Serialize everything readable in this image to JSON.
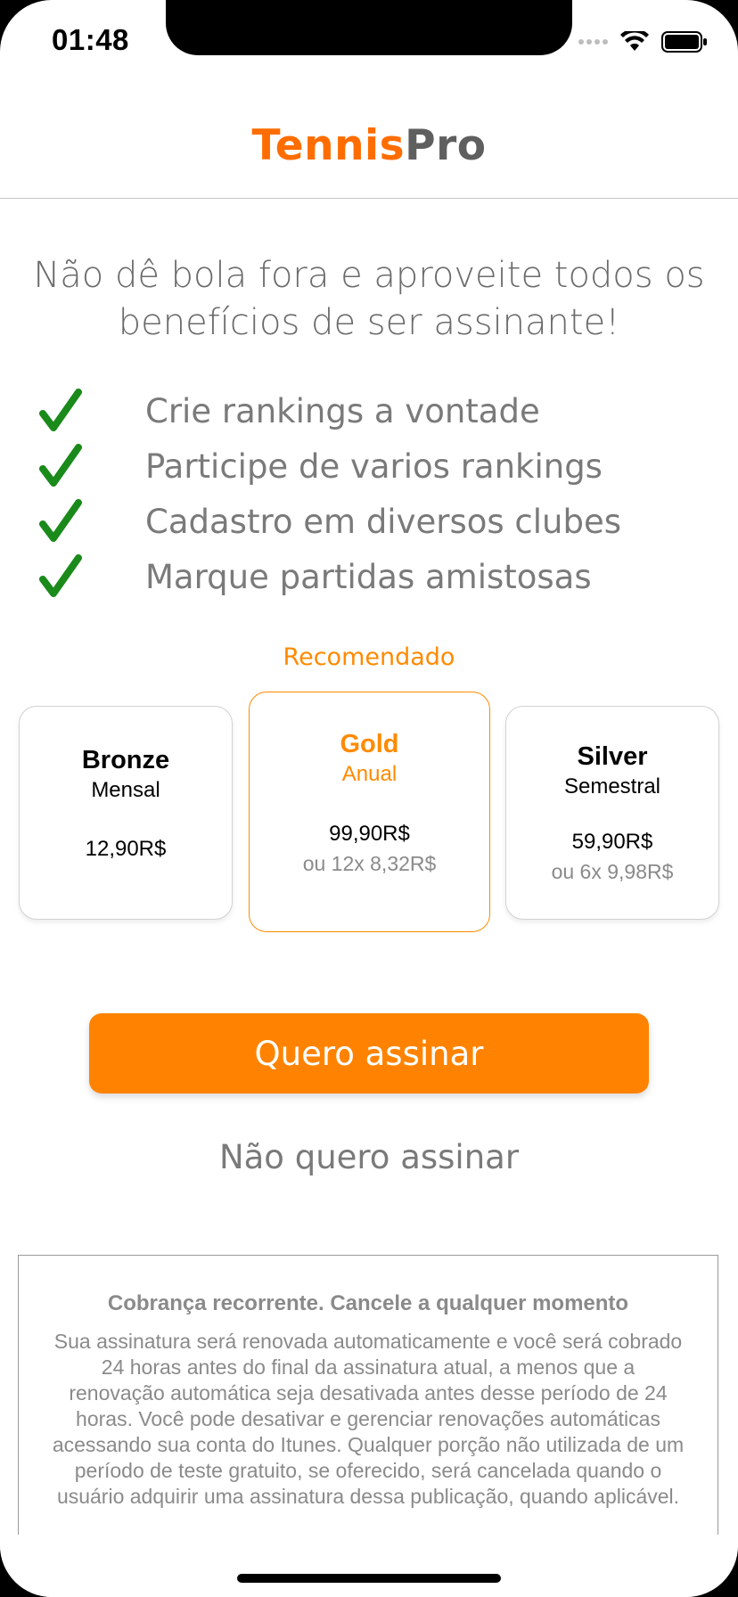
{
  "status_bar": {
    "time": "01:48"
  },
  "header": {
    "logo_part1": "Tennis",
    "logo_part2": "Pro"
  },
  "headline": "Não dê bola fora e aproveite todos os benefícios de ser assinante!",
  "benefits": [
    "Crie rankings a vontade",
    "Participe de varios rankings",
    "Cadastro em diversos clubes",
    "Marque partidas amistosas"
  ],
  "recommended_label": "Recomendado",
  "plans": [
    {
      "name": "Bronze",
      "period": "Mensal",
      "price": "12,90R$",
      "installments": ""
    },
    {
      "name": "Gold",
      "period": "Anual",
      "price": "99,90R$",
      "installments": "ou 12x 8,32R$"
    },
    {
      "name": "Silver",
      "period": "Semestral",
      "price": "59,90R$",
      "installments": "ou 6x 9,98R$"
    }
  ],
  "subscribe_label": "Quero assinar",
  "decline_label": "Não quero assinar",
  "terms": {
    "title": "Cobrança recorrente. Cancele a qualquer momento",
    "body": "Sua assinatura será renovada automaticamente e você será cobrado 24 horas antes do final da assinatura atual, a menos que a renovação automática seja desativada antes desse período de 24 horas. Você pode desativar e gerenciar renovações automáticas acessando sua conta do Itunes. Qualquer porção não utilizada de um período de teste gratuito, se oferecido, será cancelada quando o usuário adquirir uma assinatura dessa publicação, quando aplicável."
  },
  "colors": {
    "accent": "#ff8300",
    "check": "#1a8a1a",
    "text_gray": "#7a7a7a"
  }
}
